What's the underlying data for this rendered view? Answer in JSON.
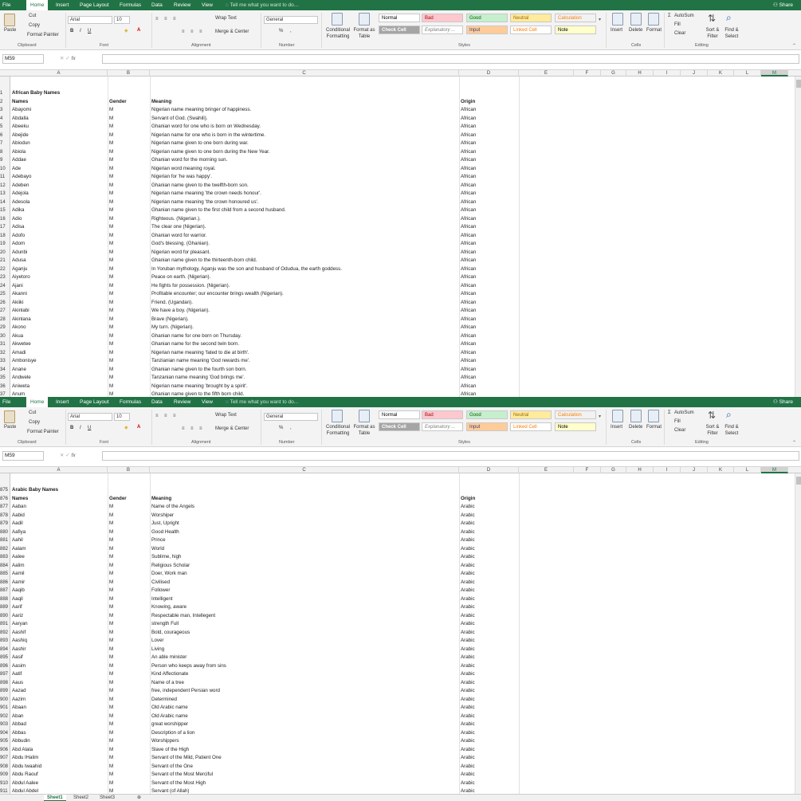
{
  "ribbon": {
    "tabs": [
      "File",
      "Home",
      "Insert",
      "Page Layout",
      "Formulas",
      "Data",
      "Review",
      "View"
    ],
    "tell_me": "Tell me what you want to do...",
    "share": "Share",
    "clipboard": {
      "paste": "Paste",
      "cut": "Cut",
      "copy": "Copy",
      "format_painter": "Format Painter",
      "label": "Clipboard"
    },
    "font": {
      "name": "Arial",
      "size": "10",
      "bold": "B",
      "italic": "I",
      "underline": "U",
      "label": "Font"
    },
    "alignment": {
      "wrap_text": "Wrap Text",
      "merge_center": "Merge & Center",
      "label": "Alignment"
    },
    "number": {
      "format": "General",
      "percent": "%",
      "comma": ",",
      "label": "Number"
    },
    "styles": {
      "conditional_formatting": "Conditional Formatting",
      "format_as_table": "Format as Table",
      "normal": "Normal",
      "bad": "Bad",
      "good": "Good",
      "neutral": "Neutral",
      "calculation": "Calculation",
      "check_cell": "Check Cell",
      "explanatory": "Explanatory ...",
      "input": "Input",
      "linked_cell": "Linked Cell",
      "note": "Note",
      "label": "Styles"
    },
    "cells": {
      "insert": "Insert",
      "delete": "Delete",
      "format": "Format",
      "label": "Cells"
    },
    "editing": {
      "autosum": "AutoSum",
      "fill": "Fill",
      "clear": "Clear",
      "sort_filter": "Sort & Filter",
      "find_select": "Find & Select",
      "label": "Editing"
    }
  },
  "formula_bar": {
    "name_box": "M59",
    "fx": "fx",
    "value": ""
  },
  "columns": [
    "A",
    "B",
    "C",
    "D",
    "E",
    "F",
    "G",
    "H",
    "I",
    "J",
    "K",
    "L",
    "M"
  ],
  "selected_column": "M",
  "sheet_tabs": [
    "Sheet1",
    "Sheet2",
    "Sheet3"
  ],
  "active_sheet": "Sheet1",
  "colors": {
    "excel_green": "#217346",
    "bad_bg": "#ffc7ce",
    "bad_fg": "#9c0006",
    "good_bg": "#c6efce",
    "good_fg": "#006100",
    "neutral_bg": "#ffeb9c",
    "neutral_fg": "#9c6500",
    "calc_bg": "#f2f2f2",
    "calc_fg": "#fa7d00",
    "check_bg": "#a5a5a5",
    "input_bg": "#ffcc99",
    "note_bg": "#ffffcc"
  },
  "windows": [
    {
      "rows": [
        {
          "n": "1",
          "a": "African Baby Names",
          "b": "",
          "c": "",
          "d": "",
          "bold": true
        },
        {
          "n": "2",
          "a": "Names",
          "b": "Gender",
          "c": "Meaning",
          "d": "Origin",
          "bold": true
        },
        {
          "n": "3",
          "a": "Abayomi",
          "b": "M",
          "c": "Nigerian name meaning bringer of happiness.",
          "d": "African"
        },
        {
          "n": "4",
          "a": "Abdalla",
          "b": "M",
          "c": "Servant of God. (Swahili).",
          "d": "African"
        },
        {
          "n": "5",
          "a": "Abeeku",
          "b": "M",
          "c": "Ghanian word for one who is born on Wednesday.",
          "d": "African"
        },
        {
          "n": "6",
          "a": "Abejide",
          "b": "M",
          "c": "Nigerian name for one who is born in the wintertime.",
          "d": "African"
        },
        {
          "n": "7",
          "a": "Abiodun",
          "b": "M",
          "c": "Nigerian name given to one born during war.",
          "d": "African"
        },
        {
          "n": "8",
          "a": "Abiola",
          "b": "M",
          "c": "Nigerian name given to one born during the New Year.",
          "d": "African"
        },
        {
          "n": "9",
          "a": "Addae",
          "b": "M",
          "c": "Ghanian word for the morning sun.",
          "d": "African"
        },
        {
          "n": "10",
          "a": "Ade",
          "b": "M",
          "c": "Nigerian word meaning royal.",
          "d": "African"
        },
        {
          "n": "11",
          "a": "Adebayo",
          "b": "M",
          "c": "Nigerian for 'he was happy'.",
          "d": "African"
        },
        {
          "n": "12",
          "a": "Adeben",
          "b": "M",
          "c": "Ghanian name given to the twelfth-born son.",
          "d": "African"
        },
        {
          "n": "13",
          "a": "Adejola",
          "b": "M",
          "c": "Nigerian name meaning 'the crown needs honour'.",
          "d": "African"
        },
        {
          "n": "14",
          "a": "Adesola",
          "b": "M",
          "c": "Nigerian name meaning 'the crown honoured us'.",
          "d": "African"
        },
        {
          "n": "15",
          "a": "Adika",
          "b": "M",
          "c": "Ghanian name given to the first child from a second husband.",
          "d": "African"
        },
        {
          "n": "16",
          "a": "Adio",
          "b": "M",
          "c": "Righteous. (Nigerian.).",
          "d": "African"
        },
        {
          "n": "17",
          "a": "Adisa",
          "b": "M",
          "c": "The clear one (Nigerian).",
          "d": "African"
        },
        {
          "n": "18",
          "a": "Adofo",
          "b": "M",
          "c": "Ghanian word for warrior.",
          "d": "African"
        },
        {
          "n": "19",
          "a": "Adom",
          "b": "M",
          "c": "God's blessing. (Ghanian).",
          "d": "African"
        },
        {
          "n": "20",
          "a": "Adunbi",
          "b": "M",
          "c": "Nigerian word for pleasant.",
          "d": "African"
        },
        {
          "n": "21",
          "a": "Adusa",
          "b": "M",
          "c": "Ghanian name given to the thirteenth-born child.",
          "d": "African"
        },
        {
          "n": "22",
          "a": "Aganju",
          "b": "M",
          "c": "In Yoruban mythology, Aganju was the son and husband of Odudua, the earth goddess.",
          "d": "African"
        },
        {
          "n": "23",
          "a": "Aiyetoro",
          "b": "M",
          "c": "Peace on earth. (Nigerian).",
          "d": "African"
        },
        {
          "n": "24",
          "a": "Ajani",
          "b": "M",
          "c": "He fights for possession. (Nigerian).",
          "d": "African"
        },
        {
          "n": "25",
          "a": "Akanni",
          "b": "M",
          "c": "Profitable encounter; our encounter brings wealth (Nigerian).",
          "d": "African"
        },
        {
          "n": "26",
          "a": "Akiiki",
          "b": "M",
          "c": "Friend. (Ugandan).",
          "d": "African"
        },
        {
          "n": "27",
          "a": "Akinlabi",
          "b": "M",
          "c": "We have a boy. (Nigerian).",
          "d": "African"
        },
        {
          "n": "28",
          "a": "Akinlana",
          "b": "M",
          "c": "Brave (Nigerian).",
          "d": "African"
        },
        {
          "n": "29",
          "a": "Akono",
          "b": "M",
          "c": "My turn. (Nigerian).",
          "d": "African"
        },
        {
          "n": "30",
          "a": "Akua",
          "b": "M",
          "c": "Ghanian name for one born on Thursday.",
          "d": "African"
        },
        {
          "n": "31",
          "a": "Akwetee",
          "b": "M",
          "c": "Ghanian name for the second twin born.",
          "d": "African"
        },
        {
          "n": "32",
          "a": "Amadi",
          "b": "M",
          "c": "Nigerian name meaning 'fated to die at birth'.",
          "d": "African"
        },
        {
          "n": "33",
          "a": "Ambonisye",
          "b": "M",
          "c": "Tanzianian name meaning 'God rewards me'.",
          "d": "African"
        },
        {
          "n": "34",
          "a": "Anane",
          "b": "M",
          "c": "Ghanian name given to the fourth son born.",
          "d": "African"
        },
        {
          "n": "35",
          "a": "Andwele",
          "b": "M",
          "c": "Tanzanian name meaning 'God brings me'.",
          "d": "African"
        },
        {
          "n": "36",
          "a": "Aniweta",
          "b": "M",
          "c": "Nigerian name meaning 'brought by a spirit'.",
          "d": "African"
        },
        {
          "n": "37",
          "a": "Anum",
          "b": "M",
          "c": "Ghanian name given to the fifth born child.",
          "d": "African"
        }
      ]
    },
    {
      "rows": [
        {
          "n": "875",
          "a": "Arabic Baby Names",
          "b": "",
          "c": "",
          "d": "",
          "bold": true
        },
        {
          "n": "876",
          "a": "Names",
          "b": "Gender",
          "c": "Meaning",
          "d": "Origin",
          "bold": true
        },
        {
          "n": "877",
          "a": "Aaban",
          "b": "M",
          "c": "Name of the Angels",
          "d": "Arabic"
        },
        {
          "n": "878",
          "a": "Aabid",
          "b": "M",
          "c": "Worshiper",
          "d": "Arabic"
        },
        {
          "n": "879",
          "a": "Aadil",
          "b": "M",
          "c": "Just, Upright",
          "d": "Arabic"
        },
        {
          "n": "880",
          "a": "Aafiya",
          "b": "M",
          "c": "Good Health",
          "d": "Arabic"
        },
        {
          "n": "881",
          "a": "Aahil",
          "b": "M",
          "c": "Prince",
          "d": "Arabic"
        },
        {
          "n": "882",
          "a": "Aalam",
          "b": "M",
          "c": "World",
          "d": "Arabic"
        },
        {
          "n": "883",
          "a": "Aalee",
          "b": "M",
          "c": "Sublime, high",
          "d": "Arabic"
        },
        {
          "n": "884",
          "a": "Aalim",
          "b": "M",
          "c": "Religious Scholar",
          "d": "Arabic"
        },
        {
          "n": "885",
          "a": "Aamil",
          "b": "M",
          "c": "Doer, Work man",
          "d": "Arabic"
        },
        {
          "n": "886",
          "a": "Aamir",
          "b": "M",
          "c": "Civilised",
          "d": "Arabic"
        },
        {
          "n": "887",
          "a": "Aaqib",
          "b": "M",
          "c": "Follower",
          "d": "Arabic"
        },
        {
          "n": "888",
          "a": "Aaqil",
          "b": "M",
          "c": "Intelligent",
          "d": "Arabic"
        },
        {
          "n": "889",
          "a": "Aarif",
          "b": "M",
          "c": "Knowing, aware",
          "d": "Arabic"
        },
        {
          "n": "890",
          "a": "Aariz",
          "b": "M",
          "c": "Respectable man, Intellegent",
          "d": "Arabic"
        },
        {
          "n": "891",
          "a": "Aaryan",
          "b": "M",
          "c": "strength Full",
          "d": "Arabic"
        },
        {
          "n": "892",
          "a": "Aashif",
          "b": "M",
          "c": "Bold, courageous",
          "d": "Arabic"
        },
        {
          "n": "893",
          "a": "Aashiq",
          "b": "M",
          "c": "Lover",
          "d": "Arabic"
        },
        {
          "n": "894",
          "a": "Aashir",
          "b": "M",
          "c": "Living",
          "d": "Arabic"
        },
        {
          "n": "895",
          "a": "Aasif",
          "b": "M",
          "c": "An able minister",
          "d": "Arabic"
        },
        {
          "n": "896",
          "a": "Aasim",
          "b": "M",
          "c": "Person who keeps away from sins",
          "d": "Arabic"
        },
        {
          "n": "897",
          "a": "Aatif",
          "b": "M",
          "c": "Kind Affectionate",
          "d": "Arabic"
        },
        {
          "n": "898",
          "a": "Aaus",
          "b": "M",
          "c": "Name of a tree",
          "d": "Arabic"
        },
        {
          "n": "899",
          "a": "Aazad",
          "b": "M",
          "c": "free, independent Persian word",
          "d": "Arabic"
        },
        {
          "n": "900",
          "a": "Aazim",
          "b": "M",
          "c": "Determined",
          "d": "Arabic"
        },
        {
          "n": "901",
          "a": "Abaan",
          "b": "M",
          "c": "Old Arabic name",
          "d": "Arabic"
        },
        {
          "n": "902",
          "a": "Aban",
          "b": "M",
          "c": "Old Arabic name",
          "d": "Arabic"
        },
        {
          "n": "903",
          "a": "Abbad",
          "b": "M",
          "c": "great worshipper",
          "d": "Arabic"
        },
        {
          "n": "904",
          "a": "Abbas",
          "b": "M",
          "c": "Description of a lion",
          "d": "Arabic"
        },
        {
          "n": "905",
          "a": "Abbudin",
          "b": "M",
          "c": "Worshippers",
          "d": "Arabic"
        },
        {
          "n": "906",
          "a": "Abd Alala",
          "b": "M",
          "c": "Slave of the High",
          "d": "Arabic"
        },
        {
          "n": "907",
          "a": "Abdu lHalim",
          "b": "M",
          "c": "Servant of the Mild, Patient One",
          "d": "Arabic"
        },
        {
          "n": "908",
          "a": "Abdu lwaahid",
          "b": "M",
          "c": "Servant of the One",
          "d": "Arabic"
        },
        {
          "n": "909",
          "a": "Abdu Raouf",
          "b": "M",
          "c": "Servant of the Most Merciful",
          "d": "Arabic"
        },
        {
          "n": "910",
          "a": "Abdul Aalee",
          "b": "M",
          "c": "Servant of the Most High",
          "d": "Arabic"
        },
        {
          "n": "911",
          "a": "Abdul Abdel",
          "b": "M",
          "c": "Servant (of Allah)",
          "d": "Arabic"
        }
      ]
    }
  ]
}
